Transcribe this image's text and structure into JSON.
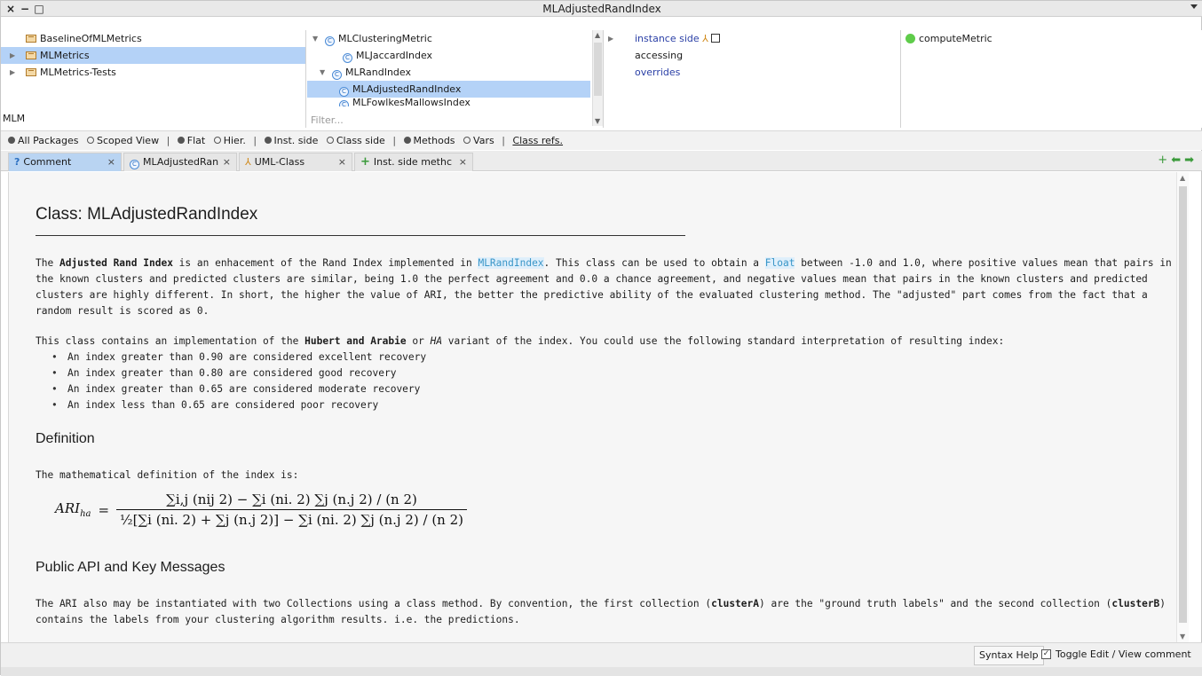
{
  "window": {
    "title": "MLAdjustedRandIndex",
    "close": "×",
    "minimize": "−",
    "maximize": "□"
  },
  "packages": {
    "items": [
      {
        "label": "BaselineOfMLMetrics"
      },
      {
        "label": "MLMetrics"
      },
      {
        "label": "MLMetrics-Tests"
      }
    ],
    "filter_value": "MLM"
  },
  "classes": {
    "items": [
      {
        "label": "MLClusteringMetric"
      },
      {
        "label": "MLJaccardIndex"
      },
      {
        "label": "MLRandIndex"
      },
      {
        "label": "MLAdjustedRandIndex"
      },
      {
        "label": "MLFowlkesMallowsIndex"
      }
    ],
    "filter_placeholder": "Filter..."
  },
  "protocols": {
    "items": [
      {
        "label": "instance side"
      },
      {
        "label": "accessing"
      },
      {
        "label": "overrides"
      }
    ]
  },
  "methods": {
    "items": [
      {
        "label": "computeMetric"
      }
    ]
  },
  "options": {
    "all_packages": "All Packages",
    "scoped_view": "Scoped View",
    "flat": "Flat",
    "hier": "Hier.",
    "inst_side": "Inst. side",
    "class_side": "Class side",
    "methods": "Methods",
    "vars": "Vars",
    "class_refs": "Class refs.",
    "separator": "|"
  },
  "tabs": [
    {
      "label": "Comment",
      "close": "×",
      "icon": "?"
    },
    {
      "label": "MLAdjustedRan",
      "close": "×",
      "icon": "C"
    },
    {
      "label": "UML-Class",
      "close": "×",
      "icon": "uml"
    },
    {
      "label": "Inst. side methc",
      "close": "×",
      "icon": "+"
    }
  ],
  "doc": {
    "title": "Class: MLAdjustedRandIndex",
    "p1_a": "The ",
    "p1_b": "Adjusted Rand Index",
    "p1_c": " is an enhacement of the Rand Index implemented in ",
    "p1_d": "MLRandIndex",
    "p1_e": ". This class can be used to obtain a ",
    "p1_f": "Float",
    "p1_g": " between -1.0 and 1.0, where positive values mean that pairs in the known clusters and predicted clusters are similar, being 1.0 the perfect agreement and 0.0 a chance agreement, and negative values mean that pairs in the known clusters and predicted clusters are highly different. In short, the higher the value of ARI, the better the predictive ability of the evaluated clustering method. The \"adjusted\" part comes from the fact that a random result is scored as 0.",
    "p2_a": "This class contains an implementation of the ",
    "p2_b": "Hubert and Arabie",
    "p2_c": " or ",
    "p2_d": "HA",
    "p2_e": " variant of the index. You could use the following standard interpretation of resulting index:",
    "bullets": [
      "An index greater than 0.90 are considered excellent recovery",
      "An index greater than 0.80 are considered good recovery",
      "An index greater than 0.65 are considered moderate recovery",
      "An index less than 0.65 are considered poor recovery"
    ],
    "h_definition": "Definition",
    "p3": "The mathematical definition of the index is:",
    "formula_lhs": "ARI",
    "formula_lhs_sub": "ha",
    "formula_eq": "=",
    "formula_num": "∑i,j (nij 2) − ∑i (ni. 2) ∑j (n.j 2) / (n 2)",
    "formula_den": "½[∑i (ni. 2) + ∑j (n.j 2)] − ∑i (ni. 2) ∑j (n.j 2) / (n 2)",
    "h_api": "Public API and Key Messages",
    "p4_a": "The ARI also may be instantiated with two Collections using a class method. By convention, the first collection (",
    "p4_b": "clusterA",
    "p4_c": ") are the \"ground truth labels\" and the second collection (",
    "p4_d": "clusterB",
    "p4_e": ") contains the labels from your clustering algorithm results. i.e. the predictions."
  },
  "footer": {
    "syntax_help": "Syntax Help",
    "toggle_label": "Toggle Edit / View comment",
    "toggle_checked": "✓"
  }
}
